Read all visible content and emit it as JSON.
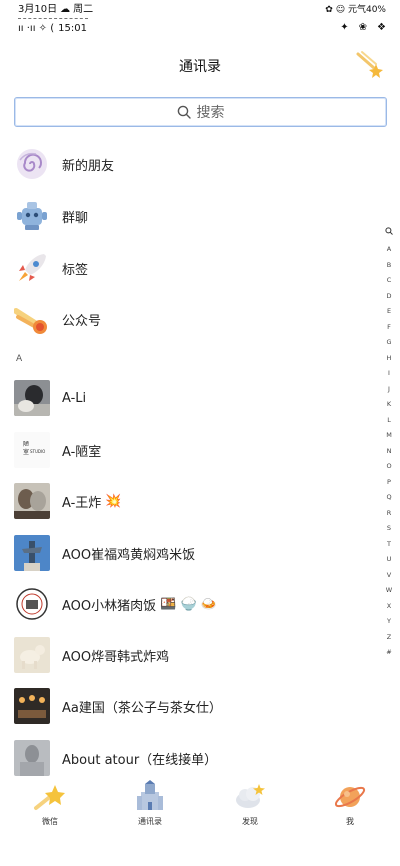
{
  "status": {
    "date": "3月10日",
    "weekday": "周二",
    "time": "15:01",
    "left_symbols": "ıı ·ıı ✧ (",
    "battery": "元气40%",
    "right_icons": [
      "signal-star-icon",
      "alarm-icon",
      "wifi-icon"
    ]
  },
  "header": {
    "title": "通讯录"
  },
  "search": {
    "placeholder": "搜索"
  },
  "fixed_items": [
    {
      "label": "新的朋友",
      "icon": "swirl-icon"
    },
    {
      "label": "群聊",
      "icon": "robot-icon"
    },
    {
      "label": "标签",
      "icon": "rocket-icon"
    },
    {
      "label": "公众号",
      "icon": "comet-icon"
    }
  ],
  "section": "A",
  "contacts": [
    {
      "name": "A-Li",
      "emoji": ""
    },
    {
      "name": "A-陋室",
      "emoji": ""
    },
    {
      "name": "A-王炸",
      "emoji": "💥"
    },
    {
      "name": "AOO崔福鸡黄焖鸡米饭",
      "emoji": ""
    },
    {
      "name": "AOO小林猪肉饭",
      "emoji": "🍱 🍚 🍛"
    },
    {
      "name": "AOO烨哥韩式炸鸡",
      "emoji": ""
    },
    {
      "name": "Aa建国（茶公子与茶女仕）",
      "emoji": ""
    },
    {
      "name": "About atour（在线接单）",
      "emoji": ""
    }
  ],
  "index_bar": [
    "A",
    "B",
    "C",
    "D",
    "E",
    "F",
    "G",
    "H",
    "I",
    "J",
    "K",
    "L",
    "M",
    "N",
    "O",
    "P",
    "Q",
    "R",
    "S",
    "T",
    "U",
    "V",
    "W",
    "X",
    "Y",
    "Z",
    "#"
  ],
  "tabs": [
    {
      "label": "微信"
    },
    {
      "label": "通讯录"
    },
    {
      "label": "发现"
    },
    {
      "label": "我"
    }
  ],
  "colors": {
    "search_border": "#9bb9e6",
    "text": "#222222"
  }
}
